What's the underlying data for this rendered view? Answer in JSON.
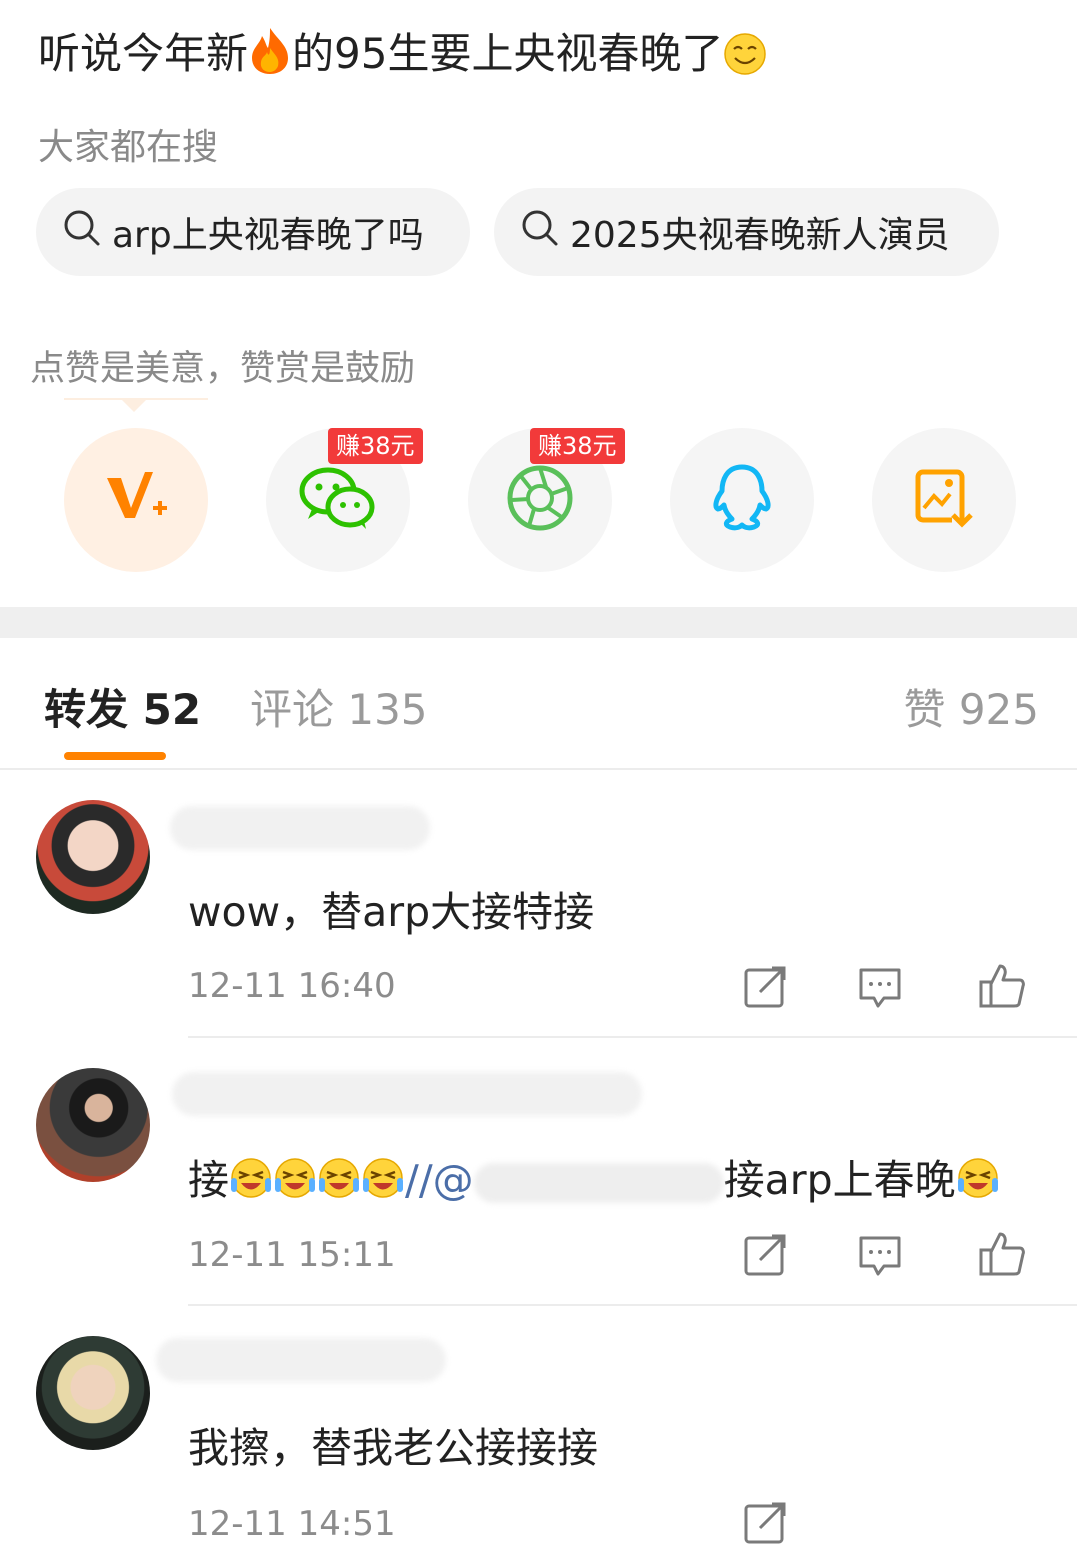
{
  "post": {
    "title_part1": "听说今年新",
    "title_part2": "的95生要上央视春晚了",
    "fire_icon": "fire-emoji",
    "smile_icon": "smirk-emoji"
  },
  "search": {
    "label": "大家都在搜",
    "chips": [
      {
        "text": "arp上央视春晚了吗"
      },
      {
        "text": "2025央视春晚新人演员"
      }
    ]
  },
  "reward": {
    "label": "点赞是美意，赞赏是鼓励",
    "badge_text": "赚38元",
    "buttons": [
      "vplus-icon",
      "wechat-icon",
      "moments-icon",
      "qq-icon",
      "save-image-icon"
    ]
  },
  "tabs": {
    "repost": "转发 52",
    "comments": "评论 135",
    "likes": "赞 925"
  },
  "comments": [
    {
      "text": "wow，替arp大接特接",
      "time": "12-11 16:40"
    },
    {
      "text_prefix": "接",
      "mention": "//@",
      "text_suffix": "接arp上春晚",
      "time": "12-11 15:11"
    },
    {
      "text": "我擦，替我老公接接接",
      "time": "12-11 14:51"
    }
  ],
  "colors": {
    "accent": "#ff8200",
    "badge": "#f23a3a",
    "wechat": "#2dc100",
    "qq": "#12b7f5"
  }
}
